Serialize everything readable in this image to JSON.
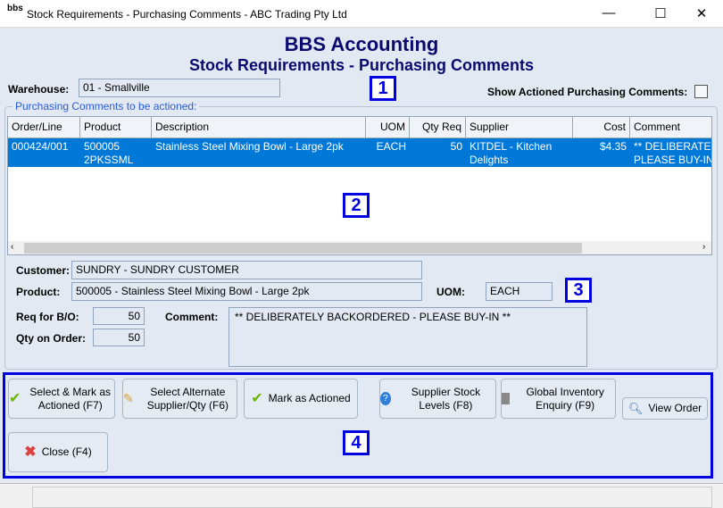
{
  "window": {
    "title": "Stock Requirements - Purchasing Comments - ABC Trading Pty Ltd",
    "logo": "bbs",
    "minimize": "—",
    "maximize": "☐",
    "close": "✕"
  },
  "header": {
    "app": "BBS Accounting",
    "title": "Stock Requirements - Purchasing Comments"
  },
  "warehouse": {
    "label": "Warehouse:",
    "value": "01 - Smallville"
  },
  "show_actioned": {
    "label": "Show Actioned Purchasing Comments:",
    "checked": false
  },
  "group_label": "Purchasing Comments to be actioned:",
  "table": {
    "columns": [
      "Order/Line",
      "Product",
      "Description",
      "UOM",
      "Qty Req",
      "Supplier",
      "Cost",
      "Comment"
    ],
    "rows": [
      {
        "order_line": "000424/001",
        "product": "500005",
        "product2": "2PKSSML",
        "description": "Stainless Steel Mixing Bowl - Large 2pk",
        "uom": "EACH",
        "qty_req": "50",
        "supplier": "KITDEL - Kitchen",
        "supplier2": "Delights",
        "cost": "$4.35",
        "comment": "** DELIBERATE",
        "comment2": "PLEASE BUY-IN"
      }
    ]
  },
  "details": {
    "customer_label": "Customer:",
    "customer": "SUNDRY - SUNDRY CUSTOMER",
    "product_label": "Product:",
    "product": "500005 - Stainless Steel Mixing Bowl - Large 2pk",
    "uom_label": "UOM:",
    "uom": "EACH",
    "req_label": "Req for B/O:",
    "req": "50",
    "qoo_label": "Qty on Order:",
    "qoo": "50",
    "comment_label": "Comment:",
    "comment": "** DELIBERATELY BACKORDERED - PLEASE BUY-IN **"
  },
  "markers": [
    "1",
    "2",
    "3",
    "4"
  ],
  "buttons": {
    "select_mark": "Select & Mark as Actioned (F7)",
    "select_alt": "Select Alternate Supplier/Qty (F6)",
    "mark": "Mark as Actioned",
    "supplier_stock": "Supplier Stock Levels (F8)",
    "global_inv": "Global Inventory Enquiry (F9)",
    "view_order": "View Order",
    "close": "Close (F4)"
  }
}
